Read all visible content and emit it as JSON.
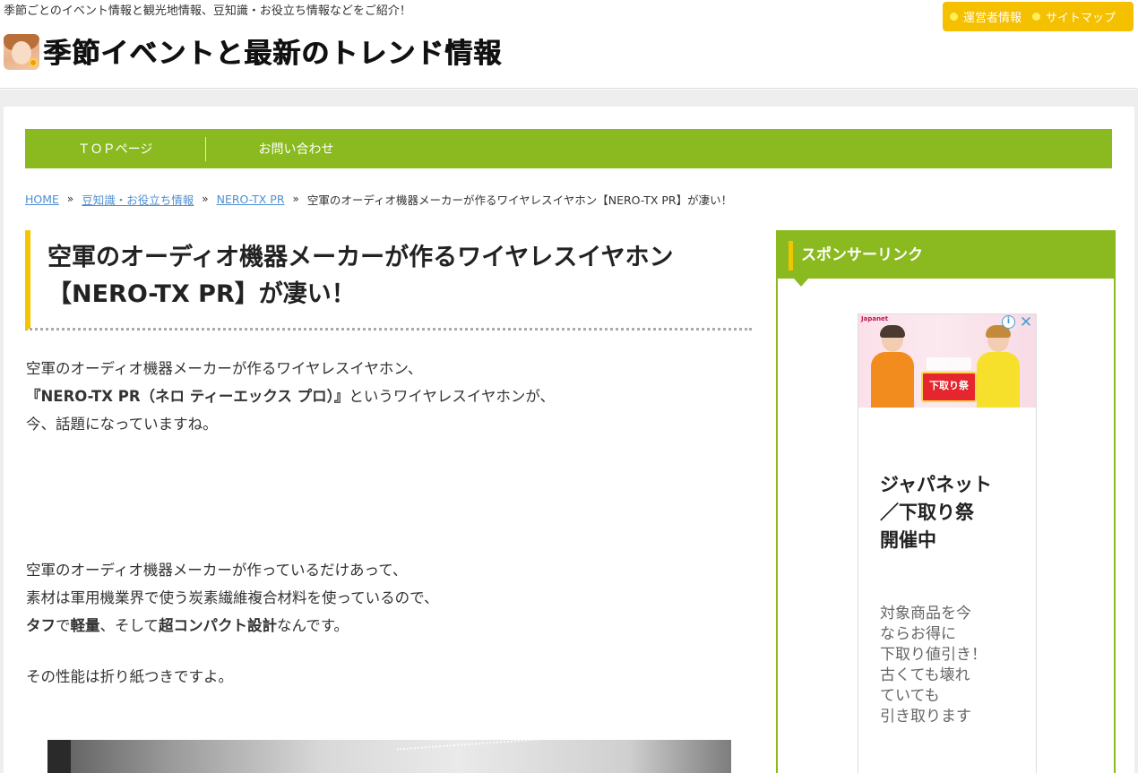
{
  "header": {
    "tagline": "季節ごとのイベント情報と観光地情報、豆知識・お役立ち情報などをご紹介！",
    "site_title": "季節イベントと最新のトレンド情報",
    "links": [
      {
        "label": "運営者情報"
      },
      {
        "label": "サイトマップ"
      }
    ]
  },
  "nav": {
    "items": [
      {
        "label": "ＴＯＰページ"
      },
      {
        "label": "お問い合わせ"
      }
    ]
  },
  "breadcrumb": {
    "items": [
      {
        "label": "HOME"
      },
      {
        "label": "豆知識・お役立ち情報"
      },
      {
        "label": "NERO-TX PR"
      }
    ],
    "separator": "»",
    "current": "空軍のオーディオ機器メーカーが作るワイヤレスイヤホン【NERO-TX PR】が凄い！"
  },
  "article": {
    "title_line1": "空軍のオーディオ機器メーカーが作るワイヤレスイヤホン",
    "title_line2": "【NERO-TX PR】が凄い！",
    "para1": {
      "line1": "空軍のオーディオ機器メーカーが作るワイヤレスイヤホン、",
      "line2_bold": "『NERO-TX PR（ネロ ティーエックス プロ）』",
      "line2_rest": "というワイヤレスイヤホンが、",
      "line3": "今、話題になっていますね。"
    },
    "para2": {
      "line1": "空軍のオーディオ機器メーカーが作っているだけあって、",
      "line2": "素材は軍用機業界で使う炭素繊維複合材料を使っているので、",
      "line3_b1": "タフ",
      "line3_t1": "で",
      "line3_b2": "軽量",
      "line3_t2": "、そして",
      "line3_b3": "超コンパクト設計",
      "line3_t3": "なんです。"
    },
    "para3": "その性能は折り紙つきですよ。"
  },
  "sidebar": {
    "widget_title": "スポンサーリンク",
    "ad": {
      "brand": "Japanet",
      "badge": "下取り祭",
      "headline_lines": [
        "ジャパネット",
        "／下取り祭",
        "開催中"
      ],
      "copy_lines": [
        "対象商品を今",
        "ならお得に",
        "下取り値引き！",
        "古くても壊れ",
        "ていても",
        "引き取ります"
      ]
    }
  },
  "colors": {
    "accent_green": "#8aba1f",
    "accent_yellow": "#f3c400",
    "link_blue": "#4d8fd0"
  }
}
